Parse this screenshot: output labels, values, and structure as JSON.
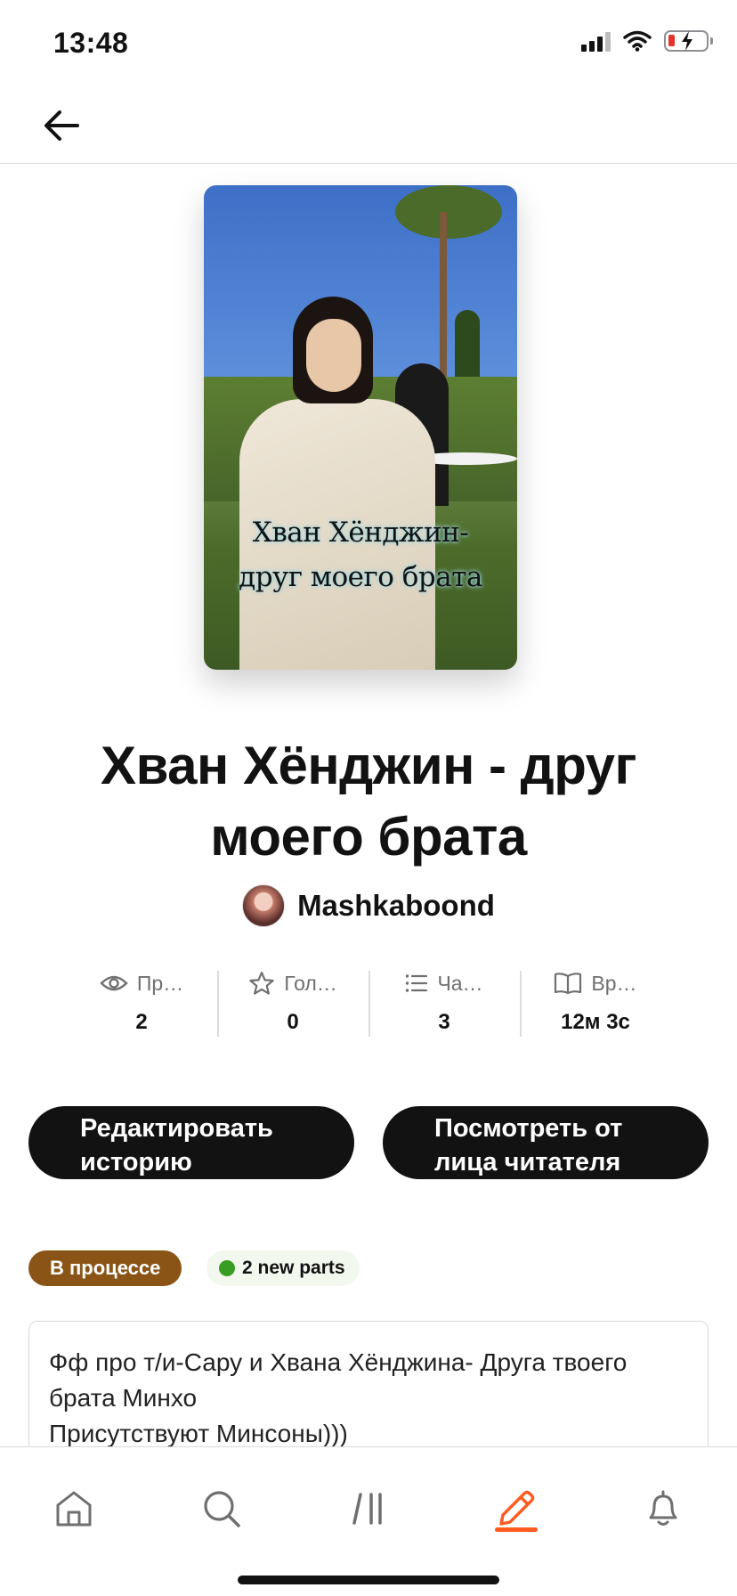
{
  "status_bar": {
    "time": "13:48"
  },
  "header": {
    "back_icon": "arrow-left-icon"
  },
  "cover": {
    "text_line1": "Хван Хёнджин-",
    "text_line2": "друг моего брата"
  },
  "story": {
    "title": "Хван Хёнджин - друг моего брата",
    "author": "Mashkaboond"
  },
  "stats": [
    {
      "icon": "eye-icon",
      "label": "Пр…",
      "value": "2"
    },
    {
      "icon": "star-icon",
      "label": "Гол…",
      "value": "0"
    },
    {
      "icon": "list-icon",
      "label": "Ча…",
      "value": "3"
    },
    {
      "icon": "book-icon",
      "label": "Вр…",
      "value": "12м 3с"
    }
  ],
  "buttons": {
    "edit": "Редактировать историю",
    "preview": "Посмотреть от лица читателя"
  },
  "tags": {
    "status": "В процессе",
    "new_parts": "2 new parts"
  },
  "description": "Фф про т/и-Сару  и Хвана Хёнджина- Друга твоего брата Минхо\nПрисутствуют Минсоны)))",
  "bottom_nav": [
    {
      "icon": "home-icon",
      "active": false
    },
    {
      "icon": "search-icon",
      "active": false
    },
    {
      "icon": "library-icon",
      "active": false
    },
    {
      "icon": "pencil-icon",
      "active": true
    },
    {
      "icon": "bell-icon",
      "active": false
    }
  ],
  "colors": {
    "accent": "#ff5a1f",
    "status_tag": "#8a5416",
    "new_dot": "#3a9d23",
    "button_bg": "#121212"
  }
}
